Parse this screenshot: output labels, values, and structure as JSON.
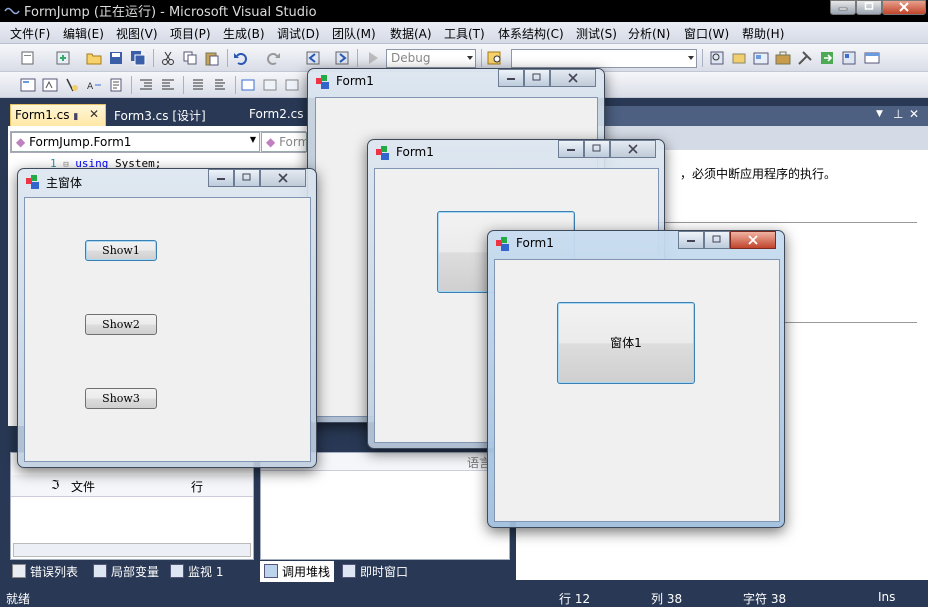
{
  "vs": {
    "title": "FormJump (正在运行) - Microsoft Visual Studio",
    "menu": [
      "文件(F)",
      "编辑(E)",
      "视图(V)",
      "项目(P)",
      "生成(B)",
      "调试(D)",
      "团队(M)",
      "数据(A)",
      "工具(T)",
      "体系结构(C)",
      "测试(S)",
      "分析(N)",
      "窗口(W)",
      "帮助(H)"
    ],
    "toolbar": {
      "config": "Debug"
    },
    "doc_tabs": [
      "Form1.cs",
      "Form3.cs [设计]",
      "Form2.cs"
    ],
    "nav_combo_left": "FormJump.Form1",
    "nav_combo_right": "Form",
    "code": {
      "line_no": "1",
      "keyword": "using",
      "rest": " System;"
    },
    "right_text": "，必须中断应用程序的执行。",
    "bottom_left": {
      "col_file": "文件",
      "col_line": "行"
    },
    "bottom_mid": {
      "col_lang": "语言"
    },
    "bottom_tabs": [
      "错误列表",
      "局部变量",
      "监视 1",
      "调用堆栈",
      "即时窗口"
    ],
    "status": {
      "ready": "就绪",
      "line": "行 12",
      "col": "列 38",
      "char": "字符 38",
      "ins": "Ins"
    }
  },
  "windows": {
    "main_form": {
      "title": "主窗体",
      "buttons": [
        "Show1",
        "Show2",
        "Show3"
      ]
    },
    "form1_back": {
      "title": "Form1"
    },
    "form1_mid": {
      "title": "Form1"
    },
    "form1_front": {
      "title": "Form1",
      "button": "窗体1"
    }
  },
  "colors": {
    "vs_bg": "#293955",
    "active_tab": "#ffe8a6",
    "aero": "#b4cde6"
  }
}
